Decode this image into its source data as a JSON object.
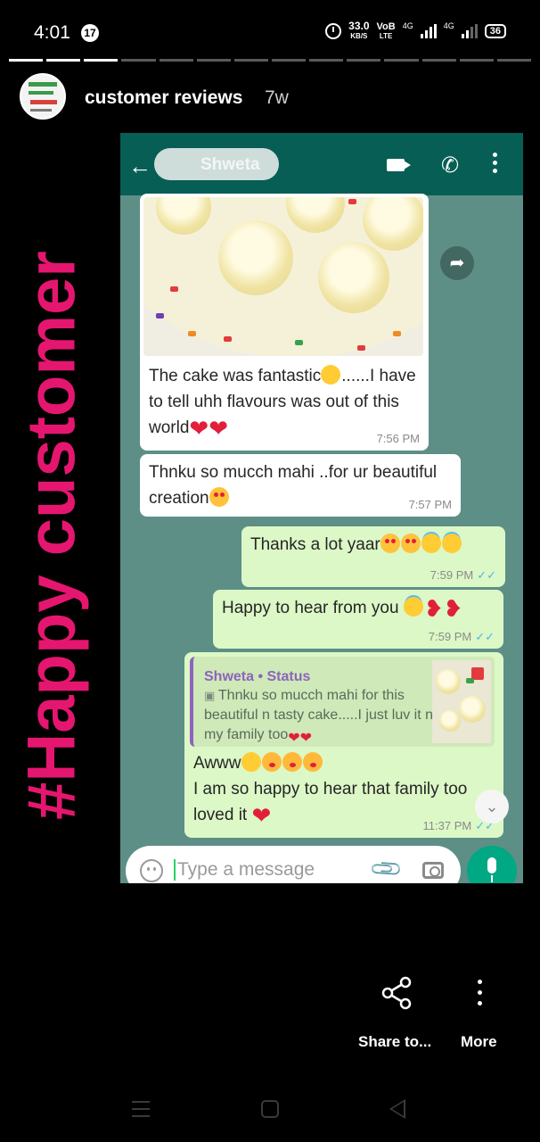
{
  "status_bar": {
    "time": "4:01",
    "notification_count": "17",
    "speed_value": "33.0",
    "speed_unit": "KB/S",
    "volte_top": "VoB",
    "volte_bottom": "LTE",
    "network_1": "4G",
    "network_2": "4G",
    "battery": "36"
  },
  "story": {
    "title": "customer reviews",
    "age": "7w",
    "progress_total": 14,
    "progress_done": 3,
    "overlay_text": "#Happy customer",
    "overlay_color": "#e5166f"
  },
  "chat": {
    "header_bg": "#075e54",
    "wallpaper": "#5d8f87",
    "contact_name": "Shweta",
    "messages": [
      {
        "dir": "in",
        "text": "The cake was fantastic",
        "text_2": "......I have to tell uhh flavours was out of this world",
        "time": "7:56 PM",
        "has_image": true
      },
      {
        "dir": "in",
        "text": "Thnku so mucch mahi ..for ur beautiful creation",
        "time": "7:57 PM"
      },
      {
        "dir": "out",
        "text": "Thanks a lot yaar",
        "time": "7:59 PM"
      },
      {
        "dir": "out",
        "text": "Happy to hear from you",
        "time": "7:59 PM"
      },
      {
        "dir": "out",
        "reply_name": "Shweta • Status",
        "reply_text": "Thnku so mucch mahi for this beautiful n tasty cake.....I just luv it n my family too",
        "text": "Awww",
        "text_2": "I am so happy to hear that family too loved it",
        "time": "11:37 PM"
      }
    ],
    "input_placeholder": "Type a message"
  },
  "actions": {
    "share_label": "Share to...",
    "more_label": "More"
  }
}
